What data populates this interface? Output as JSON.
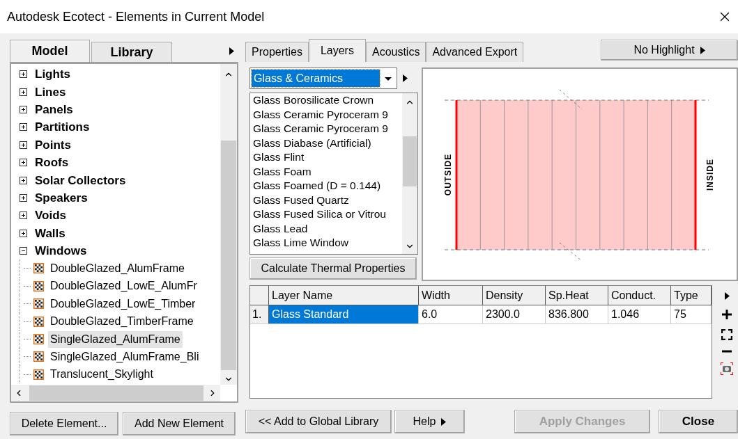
{
  "window": {
    "title": "Autodesk Ecotect - Elements in Current Model"
  },
  "left_tabs": [
    {
      "label": "Model",
      "selected": true
    },
    {
      "label": "Library",
      "selected": false
    }
  ],
  "tree": [
    {
      "label": "Lights",
      "expanded": false
    },
    {
      "label": "Lines",
      "expanded": false
    },
    {
      "label": "Panels",
      "expanded": false
    },
    {
      "label": "Partitions",
      "expanded": false
    },
    {
      "label": "Points",
      "expanded": false
    },
    {
      "label": "Roofs",
      "expanded": false
    },
    {
      "label": "Solar Collectors",
      "expanded": false
    },
    {
      "label": "Speakers",
      "expanded": false
    },
    {
      "label": "Voids",
      "expanded": false
    },
    {
      "label": "Walls",
      "expanded": false
    },
    {
      "label": "Windows",
      "expanded": true,
      "children": [
        {
          "label": "DoubleGlazed_AlumFrame",
          "selected": false
        },
        {
          "label": "DoubleGlazed_LowE_AlumFr",
          "selected": false
        },
        {
          "label": "DoubleGlazed_LowE_Timber",
          "selected": false
        },
        {
          "label": "DoubleGlazed_TimberFrame",
          "selected": false
        },
        {
          "label": "SingleGlazed_AlumFrame",
          "selected": true
        },
        {
          "label": "SingleGlazed_AlumFrame_Bli",
          "selected": false
        },
        {
          "label": "Translucent_Skylight",
          "selected": false
        }
      ]
    }
  ],
  "left_buttons": [
    {
      "label": "Delete Element..."
    },
    {
      "label": "Add New Element"
    }
  ],
  "right_tabs": [
    {
      "label": "Properties",
      "selected": false
    },
    {
      "label": "Layers",
      "selected": true
    },
    {
      "label": "Acoustics",
      "selected": false
    },
    {
      "label": "Advanced Export",
      "selected": false
    }
  ],
  "highlight_button": {
    "label": "No Highlight"
  },
  "material_dropdown": {
    "value": "Glass & Ceramics"
  },
  "materials": [
    "Glass Borosilicate Crown",
    "Glass Ceramic Pyroceram 9",
    "Glass Ceramic Pyroceram 9",
    "Glass Diabase (Artificial)",
    "Glass Flint",
    "Glass Foam",
    "Glass Foamed (D = 0.144)",
    "Glass Fused Quartz",
    "Glass Fused Silica or Vitrou",
    "Glass Lead",
    "Glass Lime Window"
  ],
  "calculate_button": {
    "label": "Calculate Thermal Properties"
  },
  "diagram": {
    "outside_label": "OUTSIDE",
    "inside_label": "INSIDE"
  },
  "table": {
    "columns": [
      "Layer Name",
      "Width",
      "Density",
      "Sp.Heat",
      "Conduct.",
      "Type"
    ],
    "rows": [
      {
        "index": "1.",
        "selected": true,
        "cells": [
          "Glass Standard",
          "6.0",
          "2300.0",
          "836.800",
          "1.046",
          "75"
        ]
      }
    ]
  },
  "bottom_buttons": [
    {
      "label": "<< Add to Global Library",
      "disabled": false,
      "kind": "plain"
    },
    {
      "label": "Help",
      "disabled": false,
      "kind": "menu"
    },
    {
      "label": "Apply Changes",
      "disabled": true,
      "kind": "bold"
    },
    {
      "label": "Close",
      "disabled": false,
      "kind": "bold"
    }
  ]
}
